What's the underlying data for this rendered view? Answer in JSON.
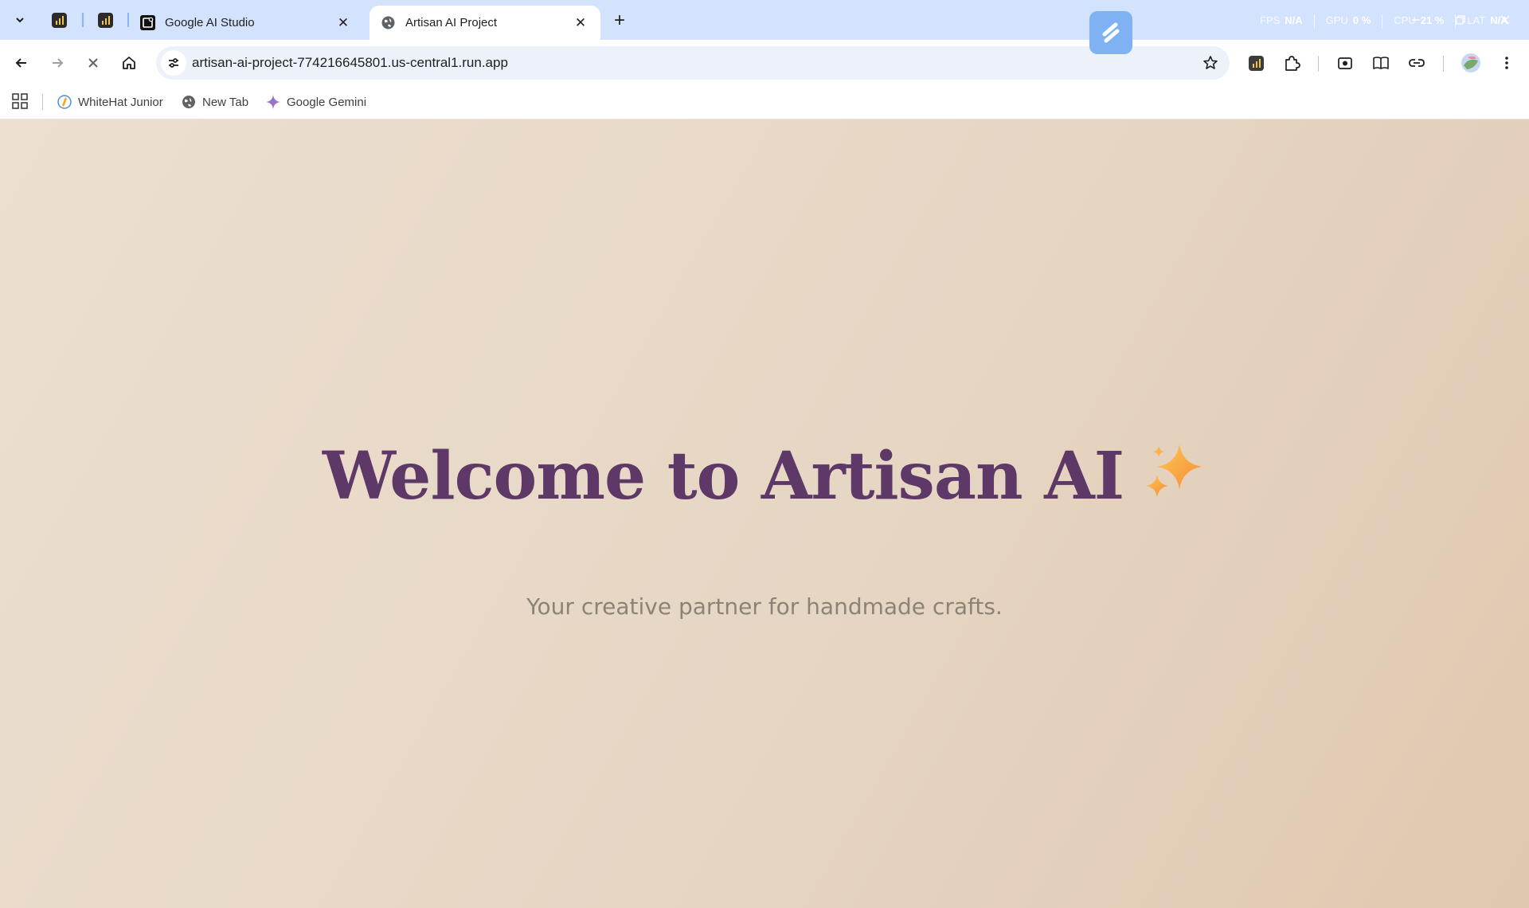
{
  "tabs": {
    "inactive": {
      "title": "Google AI Studio",
      "close": "✕"
    },
    "active": {
      "title": "Artisan AI Project",
      "close": "✕"
    },
    "new_tab": "+"
  },
  "perf_overlay": {
    "fps_label": "FPS",
    "fps_value": "N/A",
    "gpu_label": "GPU",
    "gpu_value": "0 %",
    "cpu_label": "CPU",
    "cpu_value": "21 %",
    "lat_label": "LAT",
    "lat_value": "N/A"
  },
  "toolbar": {
    "url": "artisan-ai-project-774216645801.us-central1.run.app"
  },
  "bookmarks": [
    {
      "label": "WhiteHat Junior"
    },
    {
      "label": "New Tab"
    },
    {
      "label": "Google Gemini"
    }
  ],
  "page": {
    "title": "Welcome to Artisan AI",
    "subtitle": "Your creative partner for handmade crafts."
  },
  "colors": {
    "tabstrip": "#d3e3fd",
    "omnibox": "#edf2fa",
    "title": "#5e3866",
    "subtitle": "#8c8377",
    "page_bg_start": "#ecdfd0",
    "page_bg_end": "#e0c8af"
  }
}
